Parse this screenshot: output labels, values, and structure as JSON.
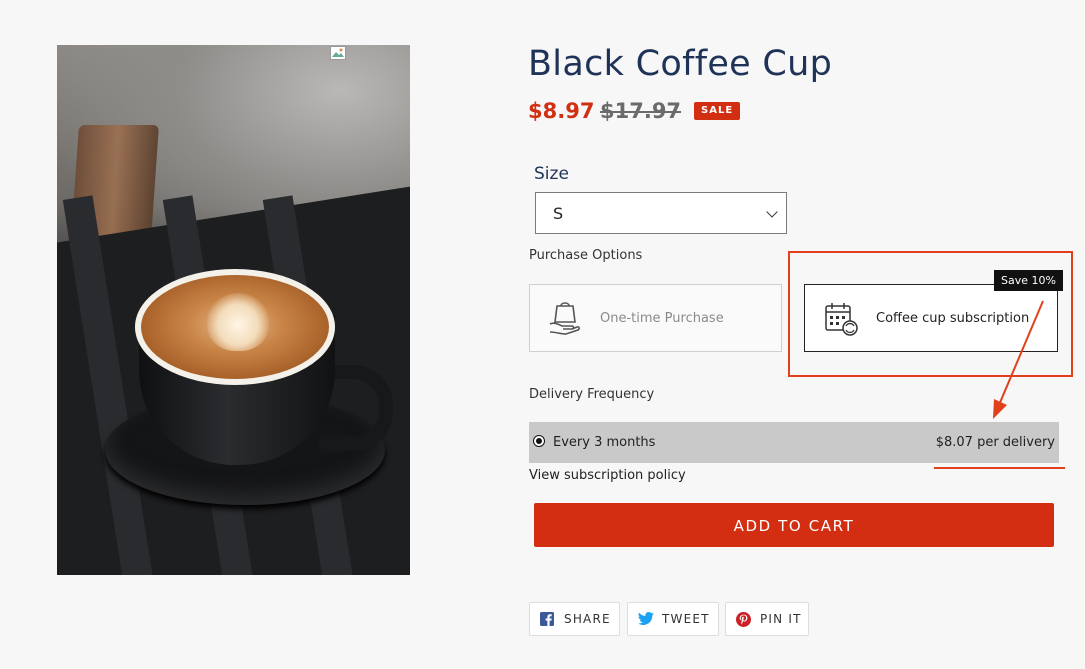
{
  "product": {
    "title": "Black Coffee Cup",
    "price": "$8.97",
    "compare_price": "$17.97",
    "sale_badge": "SALE"
  },
  "size": {
    "label": "Size",
    "selected": "S"
  },
  "purchase_options": {
    "label": "Purchase Options",
    "one_time": "One-time Purchase",
    "subscription": "Coffee cup subscription",
    "save_badge": "Save 10%"
  },
  "delivery": {
    "label": "Delivery Frequency",
    "selected": "Every 3 months",
    "price": "$8.07 per delivery"
  },
  "policy_link": "View subscription policy",
  "cart_button": "ADD TO CART",
  "share": [
    {
      "label": "SHARE",
      "icon": "facebook-icon"
    },
    {
      "label": "TWEET",
      "icon": "twitter-icon"
    },
    {
      "label": "PIN IT",
      "icon": "pinterest-icon"
    }
  ],
  "colors": {
    "accent": "#d12e12",
    "title": "#1f3358",
    "annotation": "#e0401c",
    "frequency_bg": "#c9c9c9"
  }
}
